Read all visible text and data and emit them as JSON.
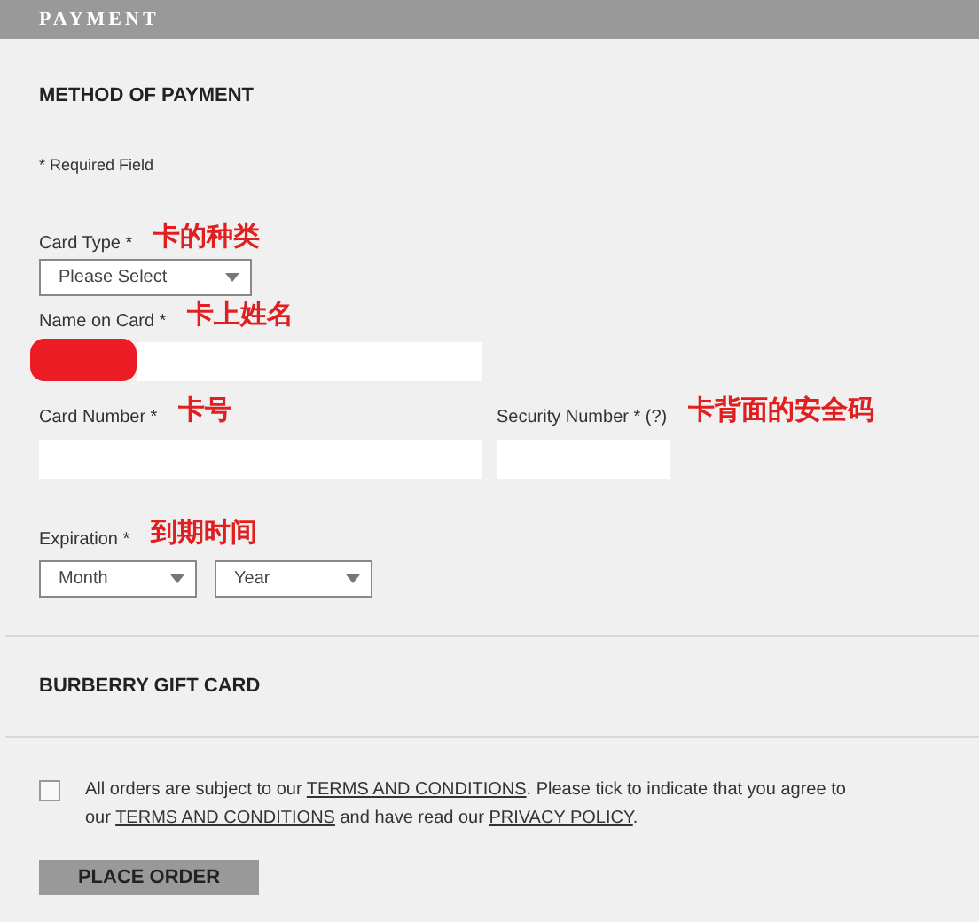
{
  "header": {
    "title": "PAYMENT"
  },
  "method": {
    "title": "METHOD OF PAYMENT",
    "required_note": "* Required Field",
    "card_type": {
      "label": "Card Type *",
      "note": "卡的种类",
      "value": "Please Select"
    },
    "name_on_card": {
      "label": "Name on Card *",
      "note": "卡上姓名",
      "redacted": true
    },
    "card_number": {
      "label": "Card Number *",
      "note": "卡号"
    },
    "security_number": {
      "label": "Security Number * (?)",
      "note": "卡背面的安全码"
    },
    "expiration": {
      "label": "Expiration *",
      "note": "到期时间",
      "selects": [
        "Month",
        "Year"
      ]
    }
  },
  "gift_card": {
    "title": "BURBERRY GIFT CARD"
  },
  "terms": {
    "checked": false,
    "parts": [
      {
        "kind": "text",
        "text": "All orders are subject to our "
      },
      {
        "kind": "link",
        "text": "TERMS AND CONDITIONS"
      },
      {
        "kind": "text",
        "text": ". Please tick to indicate that you agree to our "
      },
      {
        "kind": "link",
        "text": "TERMS AND CONDITIONS"
      },
      {
        "kind": "text",
        "text": " and have read our "
      },
      {
        "kind": "link",
        "text": "PRIVACY POLICY"
      },
      {
        "kind": "text",
        "text": "."
      }
    ]
  },
  "place_order": "PLACE ORDER"
}
